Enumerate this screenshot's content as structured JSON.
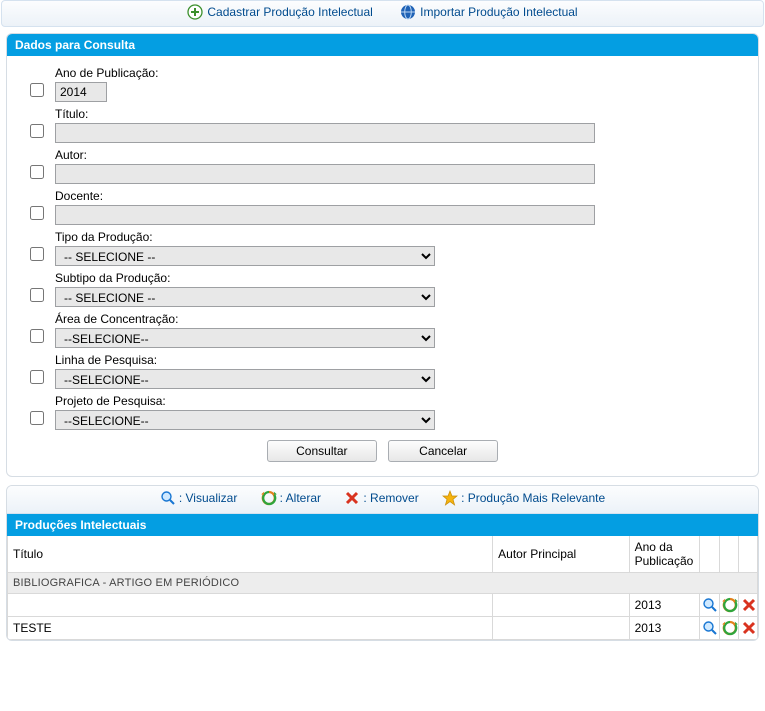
{
  "toolbar": {
    "cadastrar": "Cadastrar Produção Intelectual",
    "importar": "Importar Produção Intelectual"
  },
  "panel1_title": "Dados para Consulta",
  "fields": {
    "ano": {
      "label": "Ano de Publicação:",
      "value": "2014"
    },
    "titulo": {
      "label": "Título:",
      "value": ""
    },
    "autor": {
      "label": "Autor:",
      "value": ""
    },
    "docente": {
      "label": "Docente:",
      "value": ""
    },
    "tipo": {
      "label": "Tipo da Produção:",
      "value": "-- SELECIONE --"
    },
    "subtipo": {
      "label": "Subtipo da Produção:",
      "value": "-- SELECIONE --"
    },
    "area": {
      "label": "Área de Concentração:",
      "value": "--SELECIONE--"
    },
    "linha": {
      "label": "Linha de Pesquisa:",
      "value": "--SELECIONE--"
    },
    "projeto": {
      "label": "Projeto de Pesquisa:",
      "value": "--SELECIONE--"
    }
  },
  "buttons": {
    "consultar": "Consultar",
    "cancelar": "Cancelar"
  },
  "legend": {
    "visualizar": ": Visualizar",
    "alterar": ": Alterar",
    "remover": ": Remover",
    "relevante": ": Produção Mais Relevante"
  },
  "panel2_title": "Produções Intelectuais",
  "columns": {
    "titulo": "Título",
    "autor": "Autor Principal",
    "ano": "Ano da Publicação"
  },
  "group_row": "BIBLIOGRAFICA - ARTIGO EM PERIÓDICO",
  "rows": [
    {
      "titulo": "",
      "autor": "",
      "ano": "2013"
    },
    {
      "titulo": "TESTE",
      "autor": "",
      "ano": "2013"
    }
  ]
}
